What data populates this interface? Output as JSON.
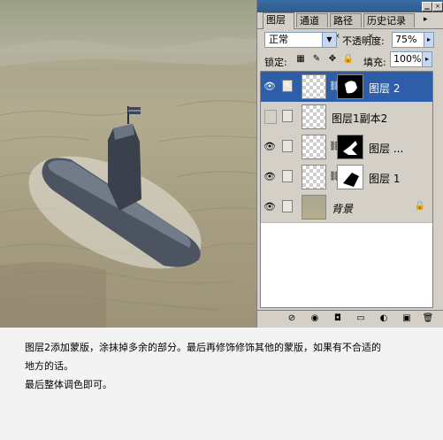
{
  "panel": {
    "tabs": [
      {
        "label": "图层",
        "close": "×"
      },
      {
        "label": "通道",
        "close": "×"
      },
      {
        "label": "路径",
        "close": "×"
      },
      {
        "label": "历史记录",
        "close": "×"
      }
    ],
    "blend_mode": "正常",
    "opacity_label": "不透明度:",
    "opacity_value": "75%",
    "lock_label": "锁定:",
    "fill_label": "填充:",
    "fill_value": "100%",
    "layers": [
      {
        "name": "图层 2",
        "visible": true,
        "selected": true,
        "has_mask": true
      },
      {
        "name": "图层1副本2",
        "visible": false,
        "selected": false,
        "has_mask": false
      },
      {
        "name": "图层 ...",
        "visible": true,
        "selected": false,
        "has_mask": true
      },
      {
        "name": "图层 1",
        "visible": true,
        "selected": false,
        "has_mask": true
      },
      {
        "name": "背景",
        "visible": true,
        "selected": false,
        "has_mask": false,
        "locked": true
      }
    ]
  },
  "caption": {
    "line1": "图层2添加蒙版，涂抹掉多余的部分。最后再修饰修饰其他的蒙版，如果有不合适的",
    "line2": "地方的话。",
    "line3": "最后整体调色即可。"
  },
  "colors": {
    "selected_row": "#2e5ea8",
    "panel_bg": "#d4d0c8",
    "title_bar": "#3a6ea5"
  },
  "icons": [
    "eye-icon",
    "brush-icon",
    "chain-link-icon",
    "lock-icon",
    "dropdown-arrow-icon"
  ]
}
